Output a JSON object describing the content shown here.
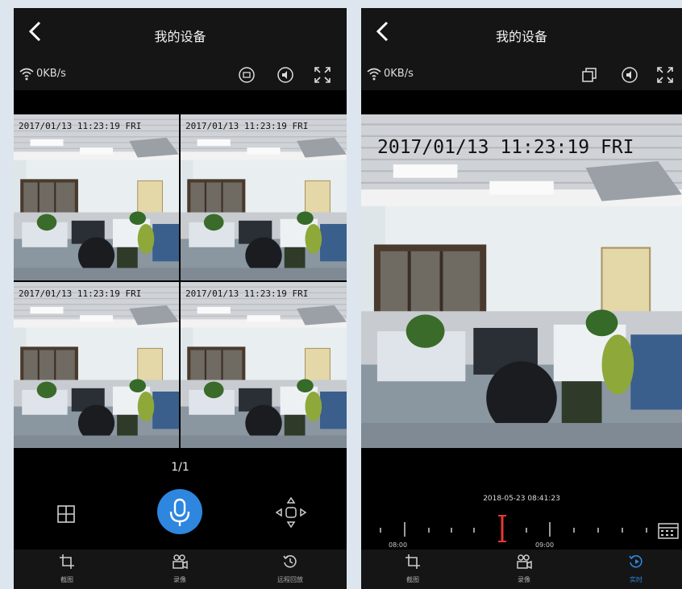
{
  "left_screen": {
    "title": "我的设备",
    "speed": "0KB/s",
    "timestamps": [
      "2017/01/13 11:23:19 FRI",
      "2017/01/13 11:23:19 FRI",
      "2017/01/13 11:23:19 FRI",
      "2017/01/13 11:23:19 FRI"
    ],
    "pager": "1/1",
    "nav": [
      {
        "label": "截图",
        "icon": "crop-icon"
      },
      {
        "label": "录像",
        "icon": "video-record-icon"
      },
      {
        "label": "远程回放",
        "icon": "playback-icon"
      }
    ]
  },
  "right_screen": {
    "title": "我的设备",
    "speed": "0KB/s",
    "timestamp": "2017/01/13 11:23:19 FRI",
    "current_time": "2018-05-23 08:41:23",
    "tick_labels": [
      "08:00",
      "09:00"
    ],
    "nav": [
      {
        "label": "截图",
        "icon": "crop-icon"
      },
      {
        "label": "录像",
        "icon": "video-record-icon"
      },
      {
        "label": "实时",
        "icon": "live-icon"
      }
    ]
  },
  "colors": {
    "accent": "#2e86de",
    "marker": "#e53935",
    "bar": "#151515"
  }
}
